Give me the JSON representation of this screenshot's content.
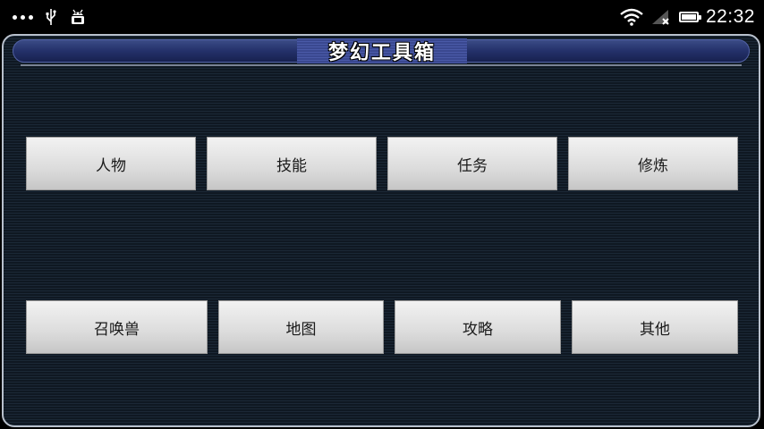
{
  "status_bar": {
    "time": "22:32",
    "icons": [
      "more-dots-icon",
      "usb-icon",
      "android-debug-icon",
      "wifi-icon",
      "cell-signal-icon",
      "battery-icon"
    ]
  },
  "header": {
    "title": "梦幻工具箱"
  },
  "buttons": {
    "row1": [
      "人物",
      "技能",
      "任务",
      "修炼"
    ],
    "row2": [
      "召唤兽",
      "地图",
      "攻略",
      "其他"
    ]
  },
  "colors": {
    "panel_bg": "#16212d",
    "title_strip": "#2a376e",
    "button_face": "#dcdcdc",
    "button_text": "#1a1a1a"
  }
}
